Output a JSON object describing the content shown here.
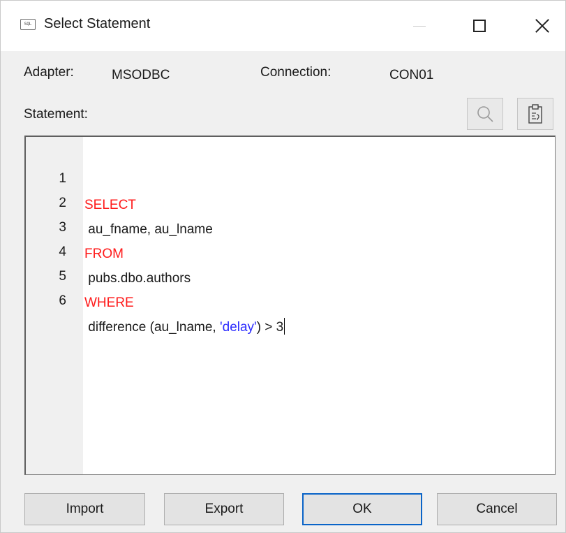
{
  "window": {
    "title": "Select Statement",
    "icon_text": "SQL"
  },
  "info": {
    "adapter_label": "Adapter:",
    "adapter_value": "MSODBC",
    "connection_label": "Connection:",
    "connection_value": "CON01",
    "statement_label": "Statement:"
  },
  "toolbar": {
    "icons": [
      "search-icon",
      "clipboard-icon"
    ]
  },
  "editor": {
    "lines": [
      {
        "no": "1",
        "text": "SELECT",
        "type": "keyword"
      },
      {
        "no": "2",
        "text": " au_fname, au_lname",
        "type": "plain"
      },
      {
        "no": "3",
        "text": "FROM",
        "type": "keyword"
      },
      {
        "no": "4",
        "text": " pubs.dbo.authors",
        "type": "plain"
      },
      {
        "no": "5",
        "text": "WHERE",
        "type": "keyword"
      },
      {
        "no": "6",
        "text_before": " difference (au_lname, ",
        "string": "'delay'",
        "text_after": ") > 3",
        "type": "mixed"
      }
    ],
    "colors": {
      "keyword": "#ff1a1a",
      "string": "#2b2bff"
    }
  },
  "buttons": {
    "import": "Import",
    "export": "Export",
    "ok": "OK",
    "cancel": "Cancel"
  }
}
